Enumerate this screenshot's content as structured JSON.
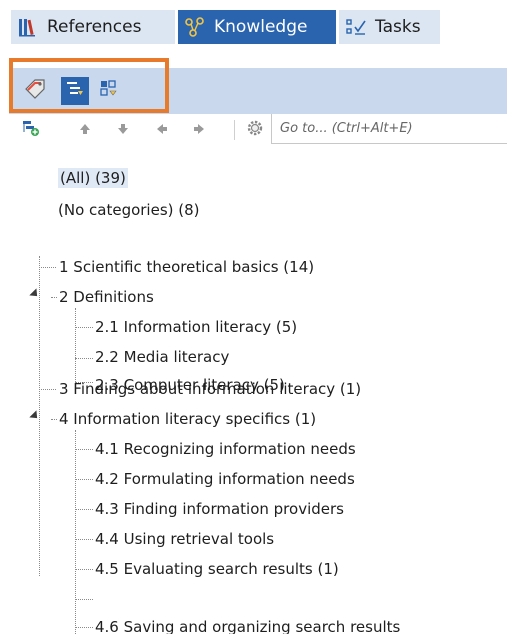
{
  "tabs": [
    {
      "label": "References",
      "icon": "references-icon",
      "active": false
    },
    {
      "label": "Knowledge",
      "icon": "knowledge-icon",
      "active": true
    },
    {
      "label": "Tasks",
      "icon": "tasks-icon",
      "active": false
    }
  ],
  "toolbar": {
    "buttons": [
      {
        "icon": "category-tag-icon",
        "selected": false
      },
      {
        "icon": "outline-view-icon",
        "selected": true
      },
      {
        "icon": "grid-view-icon",
        "selected": false
      }
    ],
    "highlight_color": "#e87a2c"
  },
  "navbar": {
    "buttons": [
      "add-category-icon",
      "move-up-icon",
      "move-down-icon",
      "move-left-icon",
      "move-right-icon",
      "settings-gear-icon"
    ],
    "goto_placeholder": "Go to... (Ctrl+Alt+E)"
  },
  "tree": {
    "all": "(All) (39)",
    "no_categories": "(No categories) (8)",
    "items": [
      {
        "label": "1 Scientific theoretical basics (14)",
        "level": 0
      },
      {
        "label": "2 Definitions",
        "level": 0,
        "expanded": true
      },
      {
        "label": "2.1 Information literacy (5)",
        "level": 1
      },
      {
        "label": "2.2 Media literacy",
        "level": 1
      },
      {
        "label": "2.3 Computer literacy (5)",
        "level": 1
      },
      {
        "label": "3 Findings about information literacy (1)",
        "level": 0
      },
      {
        "label": "4 Information literacy specifics (1)",
        "level": 0,
        "expanded": true
      },
      {
        "label": "4.1 Recognizing information needs",
        "level": 1
      },
      {
        "label": "4.2 Formulating information needs",
        "level": 1
      },
      {
        "label": "4.3 Finding information providers",
        "level": 1
      },
      {
        "label": "4.4 Using retrieval tools",
        "level": 1
      },
      {
        "label": "4.5 Evaluating search results (1)",
        "level": 1
      },
      {
        "label": "4.6 Saving and organizing search results",
        "level": 1
      }
    ]
  },
  "colors": {
    "accent": "#2a64ae",
    "tab_bg": "#dce6f3",
    "toolstrip_bg": "#c9d8ec",
    "selection_bg": "#dfe8f5"
  }
}
